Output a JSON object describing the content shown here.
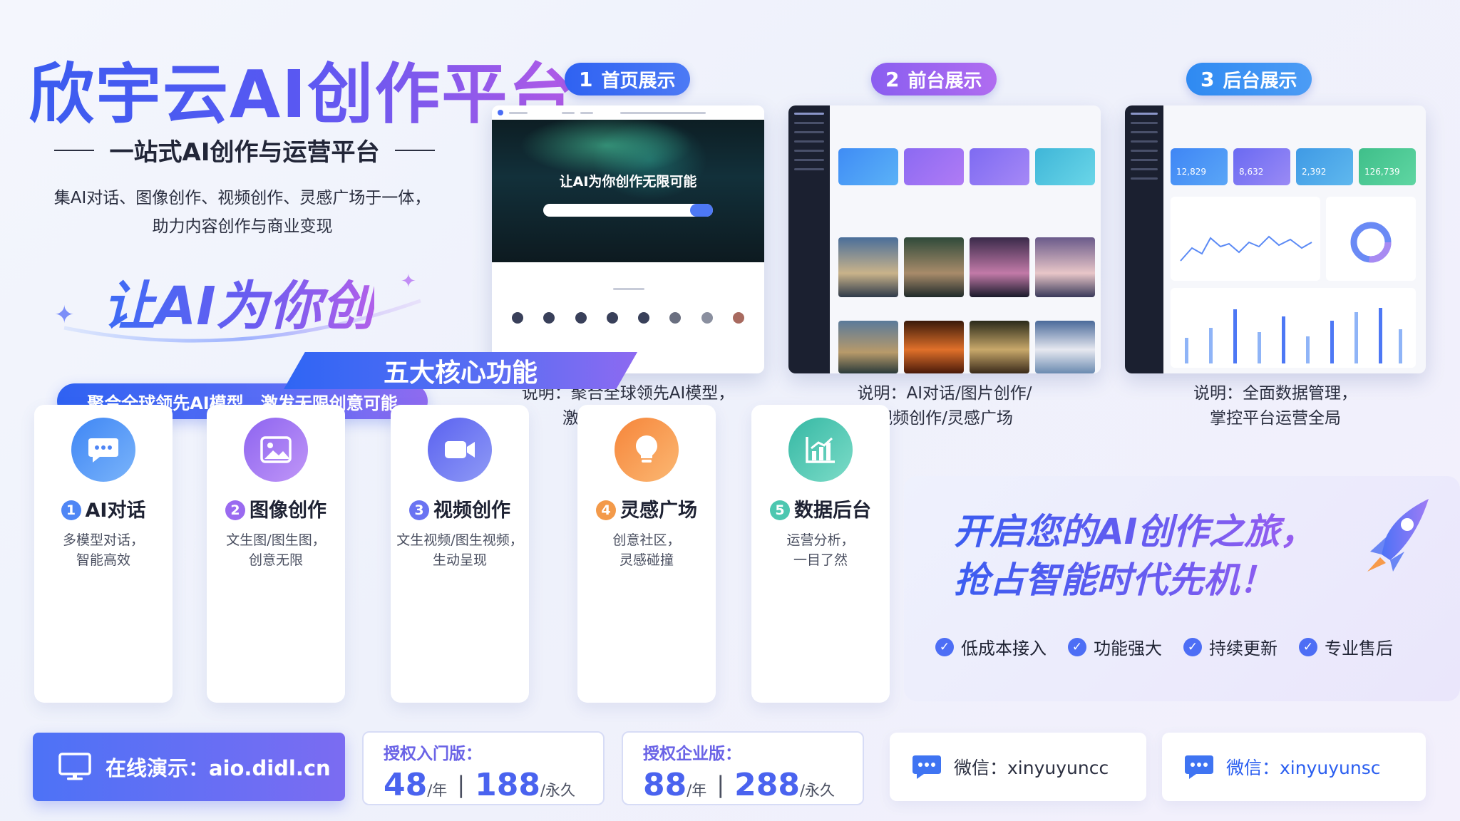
{
  "hero": {
    "title": "欣宇云AI创作平台",
    "subtitle": "一站式AI创作与运营平台",
    "desc_line1": "集AI对话、图像创作、视频创作、灵感广场于一体，",
    "desc_line2": "助力内容创作与商业变现",
    "slogan": "让AI为你创",
    "pill": "聚合全球领先AI模型，激发无限创意可能"
  },
  "showcase": [
    {
      "num": "1",
      "label": "首页展示",
      "caption_line1": "说明：聚合全球领先AI模型，",
      "caption_line2": "激发无限创意可能",
      "shot_title": "让AI为你创作无限可能"
    },
    {
      "num": "2",
      "label": "前台展示",
      "caption_line1": "说明：AI对话/图片创作/",
      "caption_line2": "视频创作/灵感广场"
    },
    {
      "num": "3",
      "label": "后台展示",
      "caption_line1": "说明：全面数据管理，",
      "caption_line2": "掌控平台运营全局",
      "stats": [
        "12,829",
        "8,632",
        "2,392",
        "126,739"
      ]
    }
  ],
  "features": {
    "section_title": "五大核心功能",
    "items": [
      {
        "num": "1",
        "name": "AI对话",
        "desc_line1": "多模型对话，",
        "desc_line2": "智能高效",
        "icon": "chat-bubble-icon",
        "color": "#4f86f5"
      },
      {
        "num": "2",
        "name": "图像创作",
        "desc_line1": "文生图/图生图，",
        "desc_line2": "创意无限",
        "icon": "image-icon",
        "color": "#9a6af0"
      },
      {
        "num": "3",
        "name": "视频创作",
        "desc_line1": "文生视频/图生视频，",
        "desc_line2": "生动呈现",
        "icon": "video-camera-icon",
        "color": "#6a73f2"
      },
      {
        "num": "4",
        "name": "灵感广场",
        "desc_line1": "创意社区，",
        "desc_line2": "灵感碰撞",
        "icon": "lightbulb-icon",
        "color": "#f39a4a"
      },
      {
        "num": "5",
        "name": "数据后台",
        "desc_line1": "运营分析，",
        "desc_line2": "一目了然",
        "icon": "chart-icon",
        "color": "#4cc7b0"
      }
    ]
  },
  "promo": {
    "line1": "开启您的AI创作之旅，",
    "line2": "抢占智能时代先机！",
    "checks": [
      "低成本接入",
      "功能强大",
      "持续更新",
      "专业售后"
    ]
  },
  "bottom": {
    "demo": "在线演示：aio.didl.cn",
    "basic": {
      "label": "授权入门版：",
      "price1": "48",
      "unit1": "/年",
      "price2": "188",
      "unit2": "/永久"
    },
    "enterprise": {
      "label": "授权企业版：",
      "price1": "88",
      "unit1": "/年",
      "price2": "288",
      "unit2": "/永久"
    },
    "wechat1": "微信：xinyuyuncc",
    "wechat2": "微信：xinyuyunsc"
  },
  "colors": {
    "primary": "#3a5cf0",
    "purple": "#8f6bf0",
    "orange": "#f39a4a",
    "teal": "#4cc7b0"
  }
}
